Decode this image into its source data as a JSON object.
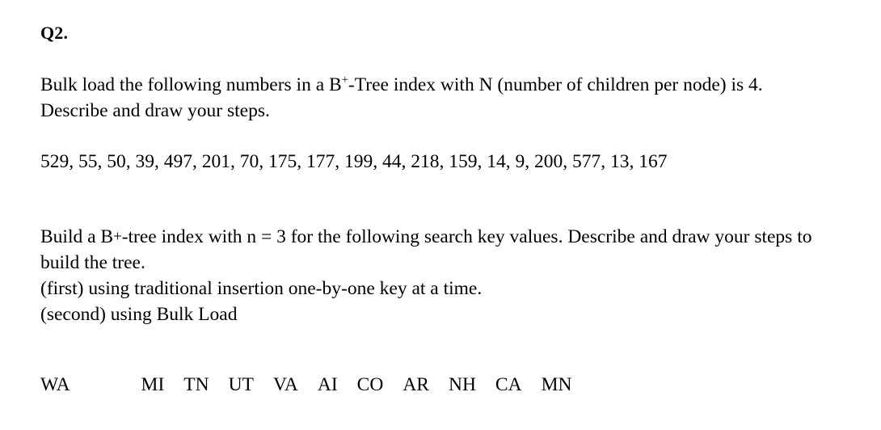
{
  "document": {
    "heading": "Q2.",
    "paragraph_bulk": {
      "text_before_sup": "Bulk load the following numbers in a B",
      "superscript": "+",
      "text_after_sup": "-Tree index with N (number of children per node) is 4. Describe and draw your steps."
    },
    "numbers_line": "529, 55, 50, 39, 497, 201, 70, 175, 177, 199, 44, 218, 159, 14, 9, 200, 577, 13, 167",
    "numbers": [
      529,
      55,
      50,
      39,
      497,
      201,
      70,
      175,
      177,
      199,
      44,
      218,
      159,
      14,
      9,
      200,
      577,
      13,
      167
    ],
    "paragraph_build": {
      "line1_before_plus": "Build a B",
      "plus": "+",
      "line1_after_plus": "-tree index with n = 3 for the following search key values. Describe and draw your steps to build the tree.",
      "line_first": "(first) using traditional insertion one-by-one key at a time.",
      "line_second": "(second) using Bulk Load"
    },
    "state_codes": [
      "WA",
      "MI",
      "TN",
      "UT",
      "VA",
      "AI",
      "CO",
      "AR",
      "NH",
      "CA",
      "MN"
    ]
  }
}
